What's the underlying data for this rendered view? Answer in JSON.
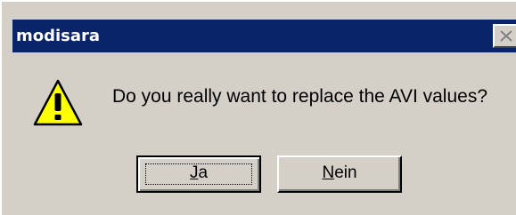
{
  "window": {
    "title": "modisara"
  },
  "message": {
    "text": "Do you really want to replace the AVI values?",
    "icon": "warning-icon"
  },
  "buttons": {
    "yes": {
      "mnemonic": "J",
      "rest": "a"
    },
    "no": {
      "mnemonic": "N",
      "rest": "ein"
    }
  },
  "colors": {
    "titlebar": "#0a246a",
    "dialog_face": "#d4d0c8",
    "warning_yellow": "#ffff00"
  }
}
